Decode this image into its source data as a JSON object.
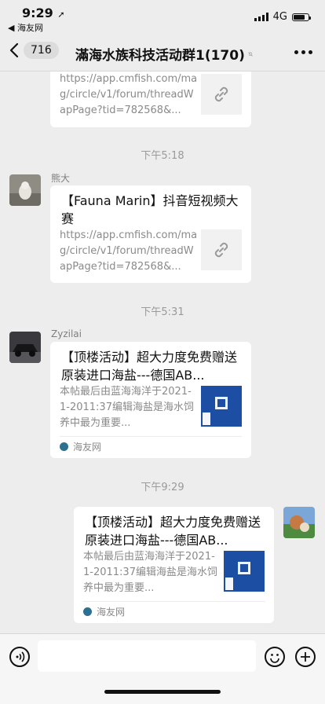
{
  "status_bar": {
    "time": "9:29",
    "location_arrow": "➚",
    "back_app": "◀ 海友网",
    "network": "4G",
    "battery_level": 0.75
  },
  "nav": {
    "unread_count": "716",
    "title": "滿海水族科技活动群1(170)"
  },
  "messages": [
    {
      "partial": true,
      "desc": "https://app.cmfish.com/mag/circle/v1/forum/threadWapPage?tid=782568&..."
    },
    {
      "timestamp": "下午5:18",
      "sender": "熊大",
      "title": "【Fauna Marin】抖音短视频大赛",
      "desc": "https://app.cmfish.com/mag/circle/v1/forum/threadWapPage?tid=782568&..."
    },
    {
      "timestamp": "下午5:31",
      "sender": "Zyzilai",
      "title": "【顶楼活动】超大力度免费赠送原装进口海盐---德国AB...",
      "desc": "本帖最后由蓝海海洋于2021-1-2011:37编辑海盐是海水饲养中最为重要...",
      "source": "海友网"
    },
    {
      "timestamp": "下午9:29",
      "sender": "",
      "title": "【顶楼活动】超大力度免费赠送原装进口海盐---德国AB...",
      "desc": "本帖最后由蓝海海洋于2021-1-2011:37编辑海盐是海水饲养中最为重要...",
      "source": "海友网"
    }
  ],
  "colors": {
    "background": "#ededed",
    "card": "#ffffff",
    "meta_text": "#9a9a9a"
  },
  "icons": [
    "back-chevron-icon",
    "mute-bell-icon",
    "more-icon",
    "link-icon",
    "voice-icon",
    "emoji-icon",
    "plus-icon"
  ]
}
